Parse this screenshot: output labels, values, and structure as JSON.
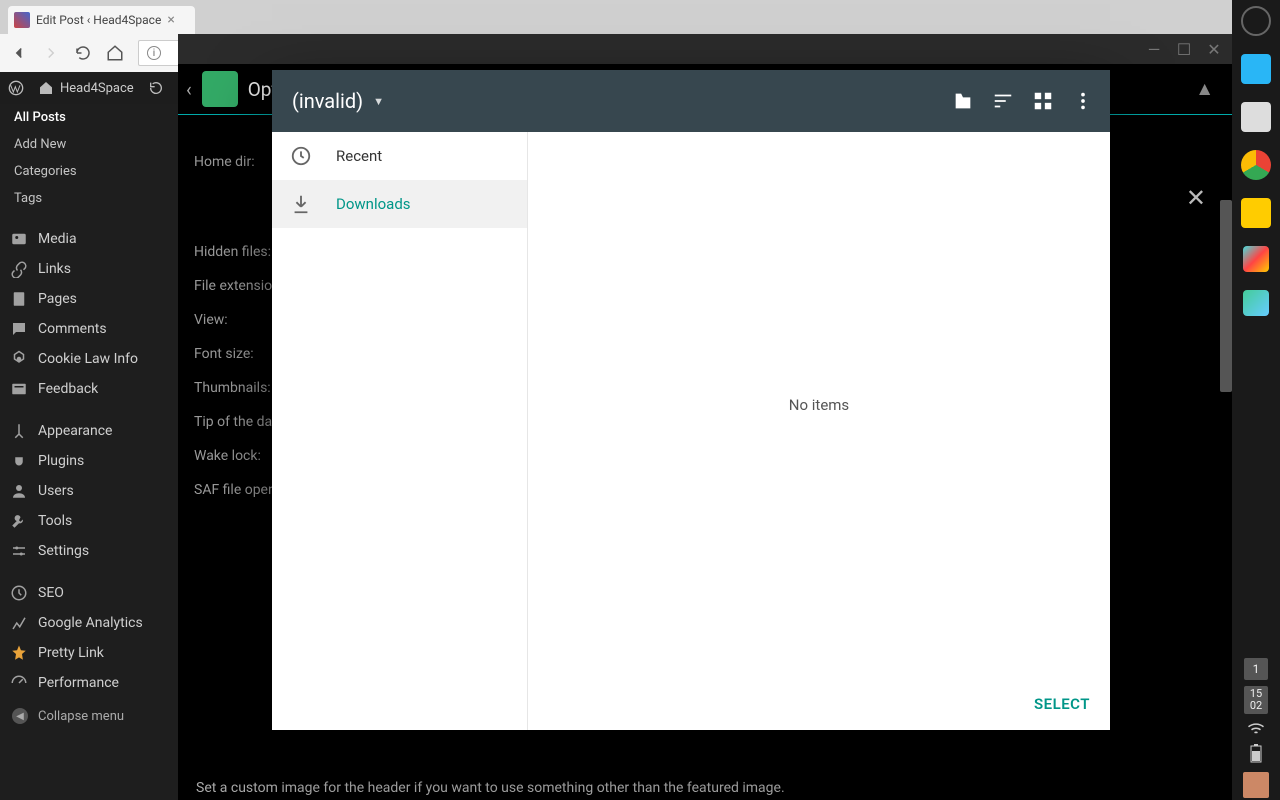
{
  "chrome": {
    "tab_title": "Edit Post ‹ Head4Space",
    "tab_close": "×"
  },
  "wp": {
    "site_name": "Head4Space",
    "submenu": {
      "all_posts": "All Posts",
      "add_new": "Add New",
      "categories": "Categories",
      "tags": "Tags"
    },
    "menu": {
      "media": "Media",
      "links": "Links",
      "pages": "Pages",
      "comments": "Comments",
      "cookie": "Cookie Law Info",
      "feedback": "Feedback",
      "appearance": "Appearance",
      "plugins": "Plugins",
      "users": "Users",
      "tools": "Tools",
      "settings": "Settings",
      "seo": "SEO",
      "ga": "Google Analytics",
      "prettylink": "Pretty Link",
      "performance": "Performance",
      "collapse": "Collapse menu"
    }
  },
  "bgwin": {
    "title_prefix": "Opt",
    "labels": {
      "home": "Home dir:",
      "hidden": "Hidden files:",
      "ext": "File extension:",
      "view": "View:",
      "fontsize": "Font size:",
      "thumbs": "Thumbnails:",
      "tip": "Tip of the day:",
      "wake": "Wake lock:",
      "saf": "SAF file open:"
    },
    "hint": "Set a custom image for the header if you want to use something other than the featured image."
  },
  "dialog": {
    "title": "(invalid)",
    "side": {
      "recent": "Recent",
      "downloads": "Downloads"
    },
    "empty": "No items",
    "select": "SELECT"
  },
  "dock": {
    "badge": "1",
    "date_top": "15",
    "date_bottom": "02"
  }
}
